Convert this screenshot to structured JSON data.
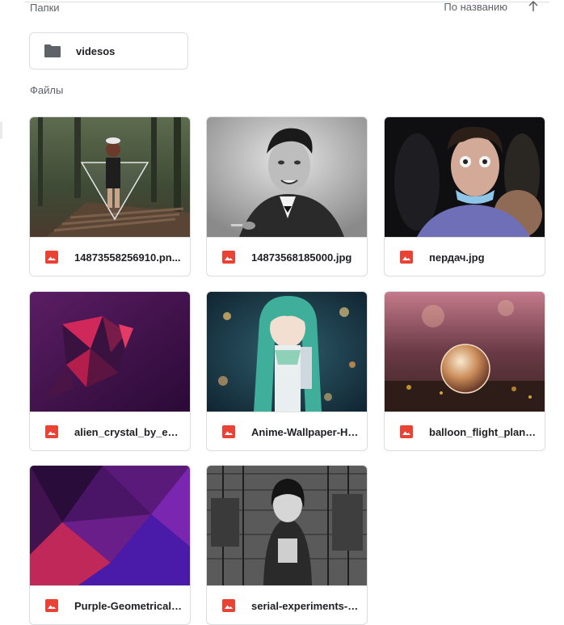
{
  "sections": {
    "folders_label": "Папки",
    "files_label": "Файлы",
    "sort_label": "По названию",
    "sort_icon": "arrow-up-icon"
  },
  "folders": [
    {
      "name": "videsos",
      "icon": "folder-icon"
    }
  ],
  "files": [
    {
      "name": "14873558256910.pn...",
      "icon": "image-file-icon",
      "thumbnail": "forest-triangle-girl"
    },
    {
      "name": "14873568185000.jpg",
      "icon": "image-file-icon",
      "thumbnail": "bw-man-portrait"
    },
    {
      "name": "пердач.jpg",
      "icon": "image-file-icon",
      "thumbnail": "party-face-photo"
    },
    {
      "name": "alien_crystal_by_eddi...",
      "icon": "image-file-icon",
      "thumbnail": "purple-crystal"
    },
    {
      "name": "Anime-Wallpaper-HD...",
      "icon": "image-file-icon",
      "thumbnail": "anime-girl-teal"
    },
    {
      "name": "balloon_flight_plant_...",
      "icon": "image-file-icon",
      "thumbnail": "glass-sphere"
    },
    {
      "name": "Purple-Geometrical-T...",
      "icon": "image-file-icon",
      "thumbnail": "purple-geometric"
    },
    {
      "name": "serial-experiments-la...",
      "icon": "image-file-icon",
      "thumbnail": "manga-city-sketch"
    }
  ],
  "colors": {
    "image_icon": "#ea4335",
    "folder_icon": "#5f6368",
    "card_border": "#dadce0"
  }
}
